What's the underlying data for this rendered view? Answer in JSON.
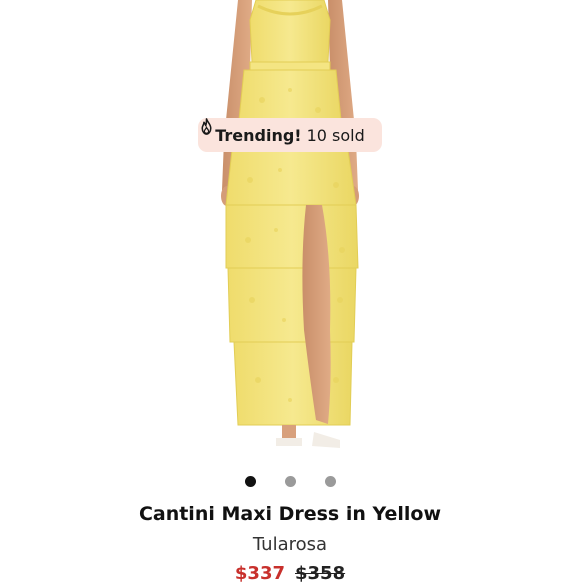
{
  "badge": {
    "label": "Trending!",
    "count": "10 sold",
    "icon": "flame-icon"
  },
  "carousel": {
    "total_slides": 3,
    "active_index": 0
  },
  "product": {
    "title": "Cantini Maxi Dress in Yellow",
    "brand": "Tularosa",
    "sale_price": "$337",
    "original_price": "$358"
  },
  "colors": {
    "badge_bg": "#fbe4dd",
    "sale_price": "#c8302c",
    "dress_yellow": "#f3e27a",
    "dot_active": "#111111",
    "dot_inactive": "#9a9a9a"
  }
}
